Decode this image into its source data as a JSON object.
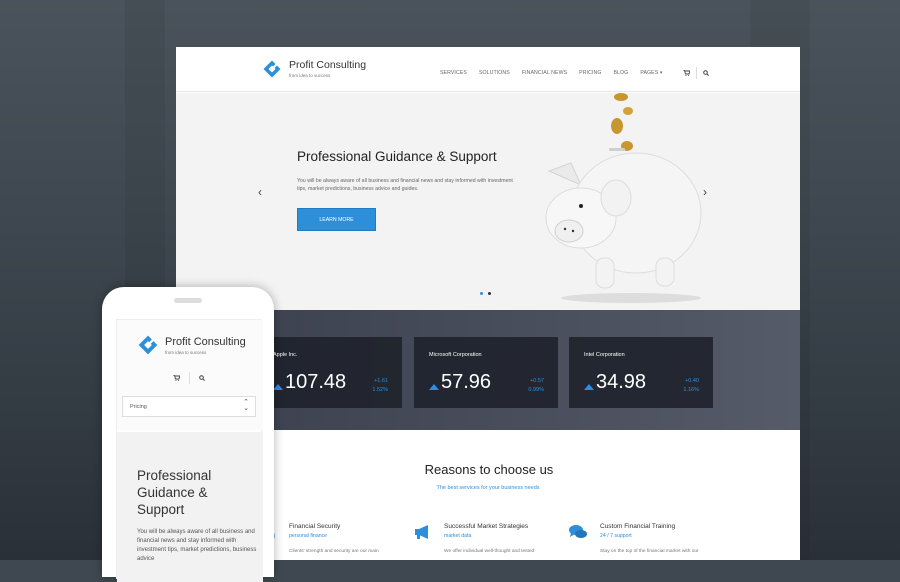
{
  "brand": {
    "title": "Profit Consulting",
    "tagline": "from idea to success",
    "accent": "#2d8fd9"
  },
  "nav": {
    "items": [
      "SERVICES",
      "SOLUTIONS",
      "FINANCIAL NEWS",
      "PRICING",
      "BLOG",
      "PAGES ▾"
    ],
    "icons": [
      "cart-icon",
      "search-icon"
    ]
  },
  "hero": {
    "title": "Professional Guidance & Support",
    "text": "You will be always aware of all business and financial news and stay informed with investment tips, market predictions, business advice and guides.",
    "button": "LEARN MORE",
    "prev": "‹",
    "next": "›",
    "slides": 2,
    "active_slide": 1
  },
  "stocks": [
    {
      "name": "Apple Inc.",
      "price": "107.48",
      "change": "+1.61",
      "percent": "1.52%"
    },
    {
      "name": "Microsoft Corporation",
      "price": "57.96",
      "change": "+0.57",
      "percent": "0.99%"
    },
    {
      "name": "Intel Corporation",
      "price": "34.98",
      "change": "+0.40",
      "percent": "1.16%"
    }
  ],
  "reasons": {
    "title": "Reasons to choose us",
    "subtitle": "The best services for your business needs",
    "features": [
      {
        "title": "Financial Security",
        "sub": "personal finance",
        "desc": "Clients' strength and security are our main",
        "icon": "shield-icon"
      },
      {
        "title": "Successful Market Strategies",
        "sub": "market data",
        "desc": "We offer individual well-thought and tested",
        "icon": "megaphone-icon"
      },
      {
        "title": "Custom Financial Training",
        "sub": "24 / 7 support",
        "desc": "Stay on the top of the financial market with our",
        "icon": "chat-icon"
      }
    ]
  },
  "mobile": {
    "select_value": "Pricing",
    "hero_title": "Professional Guidance & Support",
    "hero_text": "You will be always aware of all business and financial news and stay informed with investment tips, market predictions, business advice"
  }
}
